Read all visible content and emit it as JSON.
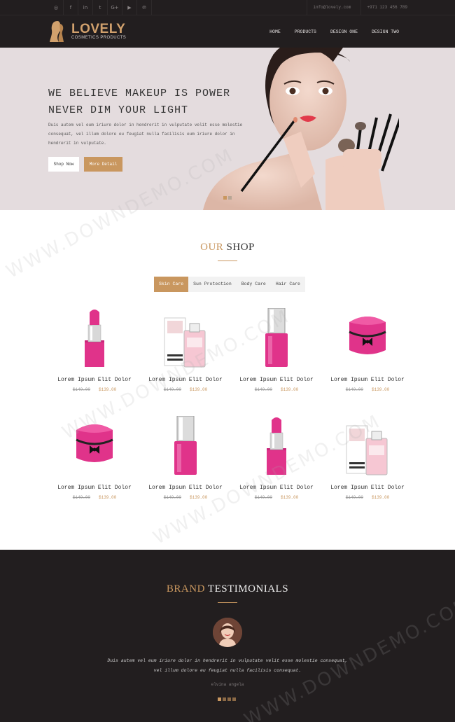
{
  "topbar": {
    "social_icons": [
      "instagram-icon",
      "facebook-icon",
      "linkedin-icon",
      "twitter-icon",
      "google-plus-icon",
      "youtube-icon",
      "pinterest-icon"
    ],
    "social_glyphs": [
      "◎",
      "f",
      "in",
      "t",
      "G+",
      "▶",
      "℗"
    ],
    "email": "info@lovely.com",
    "phone": "+971 123 456 789"
  },
  "header": {
    "logo_title": "LOVELY",
    "logo_subtitle": "COSMETICS PRODUCTS",
    "nav": [
      "HOME",
      "PRODUCTS",
      "DESIGN ONE",
      "DESIGN TWO"
    ]
  },
  "hero": {
    "title": "WE BELIEVE MAKEUP IS POWER NEVER DIM YOUR LIGHT",
    "text": "Duis autem vel eum iriure dolor in hendrerit in vulputate velit esse molestie consequat, vel illum dolore eu feugiat nulla facilisis eum iriure dolor in hendrerit in vulputate.",
    "shop_button": "Shop Now",
    "more_button": "More Detail"
  },
  "shop": {
    "title_accent": "OUR",
    "title_main": "SHOP",
    "tabs": [
      "Skin Care",
      "Sun Protection",
      "Body Care",
      "Hair Care"
    ],
    "active_tab": 0,
    "products": [
      {
        "name": "Lorem Ipsum Elit Dolor",
        "old_price": "$149.00",
        "price": "$139.00",
        "kind": "lipstick"
      },
      {
        "name": "Lorem Ipsum Elit Dolor",
        "old_price": "$149.00",
        "price": "$139.00",
        "kind": "perfume"
      },
      {
        "name": "Lorem Ipsum Elit Dolor",
        "old_price": "$149.00",
        "price": "$139.00",
        "kind": "nailpolish"
      },
      {
        "name": "Lorem Ipsum Elit Dolor",
        "old_price": "$149.00",
        "price": "$139.00",
        "kind": "bag"
      },
      {
        "name": "Lorem Ipsum Elit Dolor",
        "old_price": "$149.00",
        "price": "$139.00",
        "kind": "bag"
      },
      {
        "name": "Lorem Ipsum Elit Dolor",
        "old_price": "$149.00",
        "price": "$139.00",
        "kind": "nailpolish"
      },
      {
        "name": "Lorem Ipsum Elit Dolor",
        "old_price": "$149.00",
        "price": "$139.00",
        "kind": "lipstick"
      },
      {
        "name": "Lorem Ipsum Elit Dolor",
        "old_price": "$149.00",
        "price": "$139.00",
        "kind": "perfume"
      }
    ]
  },
  "testimonials": {
    "title_accent": "BRAND",
    "title_main": "TESTIMONIALS",
    "quote": "Duis autem vel eum iriure dolor in hendrerit in vulputate velit esse molestie consequat, vel illum dolore eu feugiat nulla facilisis consequat.",
    "author": "elvina angela"
  },
  "watermark_text": "WWW.DOWNDEMO.COM",
  "colors": {
    "accent": "#c9975f",
    "dark": "#221e1f",
    "hero_bg": "#e4dcde",
    "pink": "#e0338a"
  }
}
